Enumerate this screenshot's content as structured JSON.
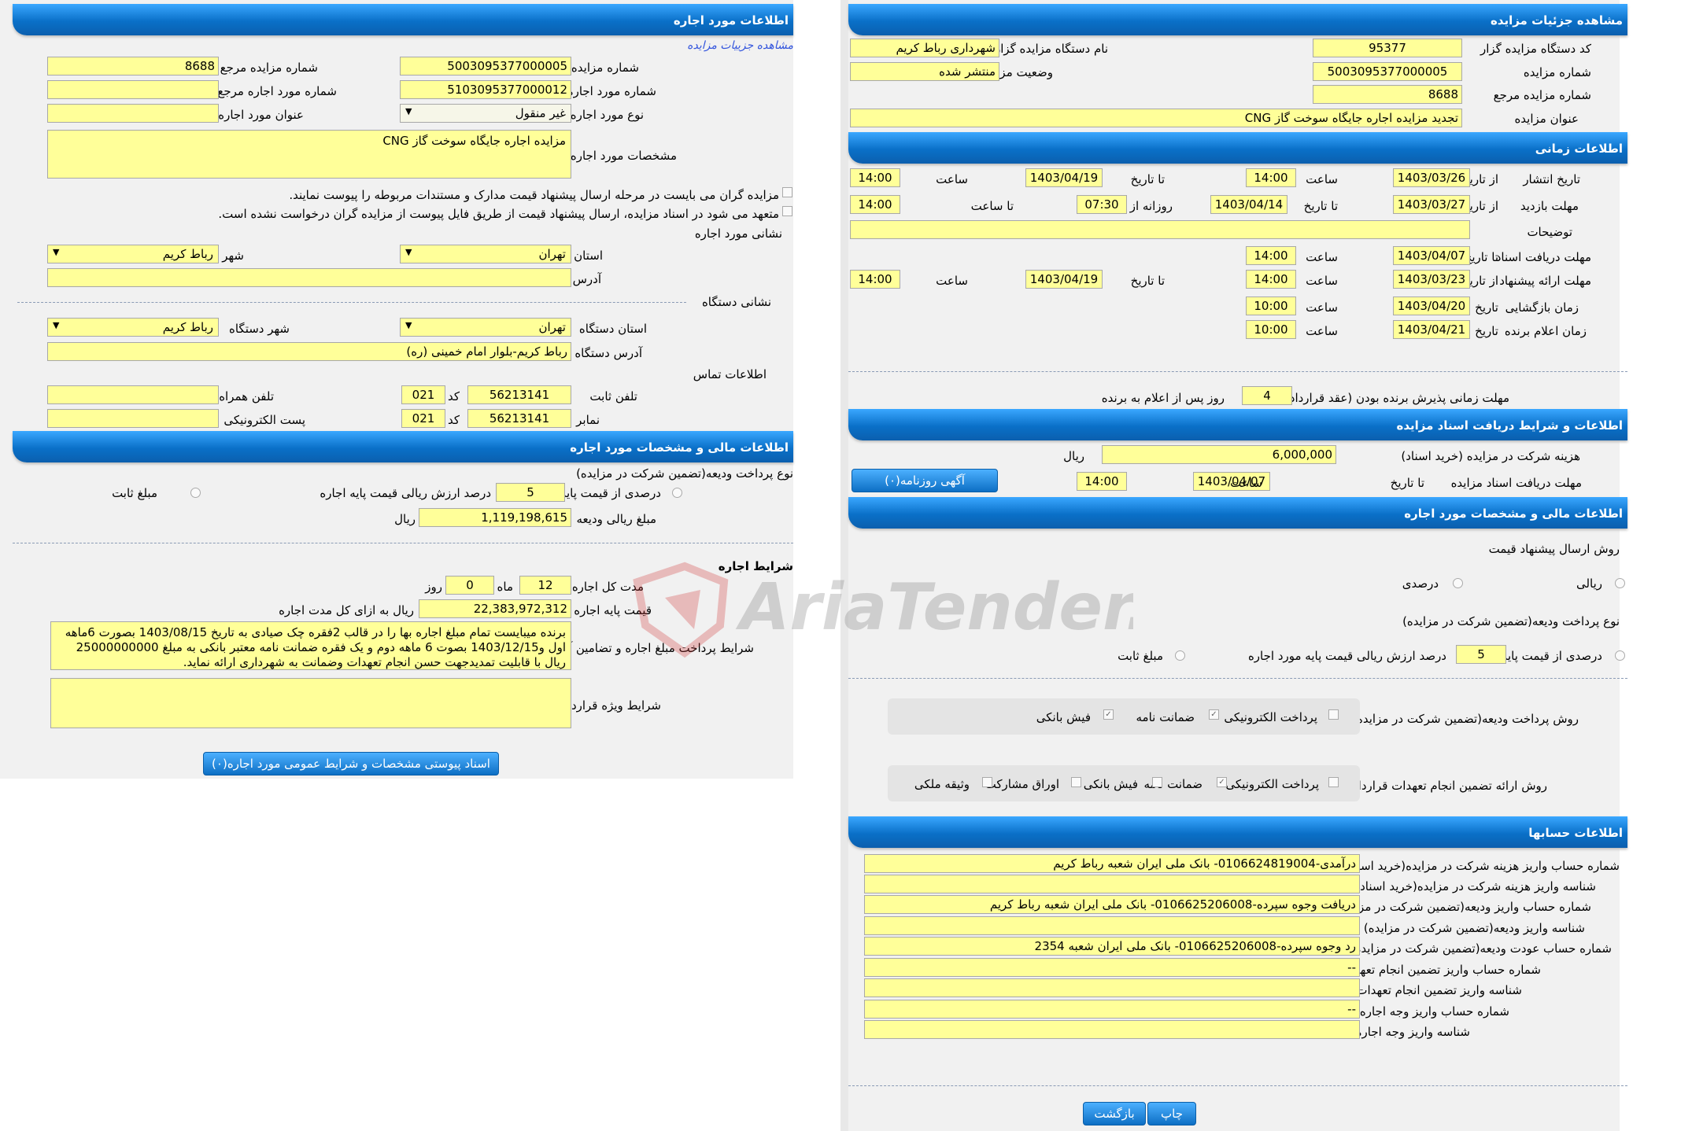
{
  "right": {
    "h_details": "مشاهده جزئیات مزایده",
    "org_code_label": "کد دستگاه مزایده گزار",
    "org_code": "95377",
    "org_name_label": "نام دستگاه مزایده گزار",
    "org_name": "شهرداری رباط کریم",
    "auction_no_label": "شماره مزایده",
    "auction_no": "5003095377000005",
    "status_label": "وضعیت مزایده",
    "status": "منتشر شده",
    "ref_no_label": "شماره مزایده مرجع",
    "ref_no": "8688",
    "title_label": "عنوان مزایده",
    "title": "تجدید مزایده اجاره جایگاه سوخت گاز CNG",
    "h_time": "اطلاعات زمانی",
    "publish_label": "تاریخ انتشار",
    "visit_label": "مهلت بازدید",
    "notes_label": "توضیحات",
    "docs_deadline_label": "مهلت دریافت اسناد",
    "offer_deadline_label": "مهلت ارائه پیشنهاد",
    "opening_label": "زمان بازگشایی",
    "winner_label": "زمان اعلام برنده",
    "from_date": "از تاریخ",
    "to_date": "تا تاریخ",
    "time": "ساعت",
    "date": "تاریخ",
    "daily_from": "روزانه از ساعت",
    "to_time": "تا ساعت",
    "publish_from": "1403/03/26",
    "publish_from_time": "14:00",
    "publish_to": "1403/04/19",
    "publish_to_time": "14:00",
    "visit_from": "1403/03/27",
    "visit_to": "1403/04/14",
    "visit_start": "07:30",
    "visit_end": "14:00",
    "docs_to": "1403/04/07",
    "docs_time": "14:00",
    "offer_from": "1403/03/23",
    "offer_from_time": "14:00",
    "offer_to": "1403/04/19",
    "offer_to_time": "14:00",
    "opening_date": "1403/04/20",
    "opening_time": "10:00",
    "winner_date": "1403/04/21",
    "winner_time": "10:00",
    "accept_label": "مهلت زمانی پذیرش برنده بودن (عقد قرارداد)",
    "accept_days": "4",
    "accept_suffix": "روز پس از اعلام به برنده",
    "h_docs": "اطلاعات و شرایط دریافت اسناد مزایده",
    "fee_label": "هزینه شرکت در مزایده (خرید اسناد)",
    "fee": "6,000,000",
    "rial": "ریال",
    "docs_recv_label": "مهلت دریافت اسناد مزایده",
    "docs_recv_to": "تا تاریخ",
    "docs_recv_date": "1403/04/07",
    "docs_recv_time": "14:00",
    "newspaper_btn": "آگهی روزنامه(۰)",
    "h_fin": "اطلاعات مالی و مشخصات مورد اجاره",
    "price_method_label": "روش ارسال پیشنهاد قیمت",
    "rial_opt": "ریالی",
    "percent_opt": "درصدی",
    "deposit_type_label": "نوع پرداخت ودیعه(تضمین شرکت در مزایده)",
    "percent_base_label": "درصدی از قیمت پایه",
    "percent_value": "5",
    "percent_desc": "درصد ارزش ریالی قیمت پایه مورد اجاره",
    "fixed_label": "مبلغ ثابت",
    "deposit_method_label": "روش پرداخت ودیعه(تضمین شرکت در مزایده)",
    "guarantee_method_label": "روش ارائه تضمین انجام تعهدات قرارداد",
    "electronic": "پرداخت الکترونیکی",
    "guarantee_letter": "ضمانت نامه",
    "bank_receipt": "فیش بانکی",
    "bonds": "اوراق مشارکت",
    "property": "وثیقه ملکی",
    "h_accounts": "اطلاعات حسابها",
    "acc1_label": "شماره حساب واریز هزینه شرکت در مزایده(خرید اسناد)",
    "acc1": "درآمدی-0106624819004- بانک ملی ایران شعبه رباط کریم",
    "acc2_label": "شناسه واریز هزینه شرکت در مزایده(خرید اسناد)",
    "acc2": "",
    "acc3_label": "شماره حساب واریز ودیعه(تضمین شرکت در مزایده)",
    "acc3": "دریافت وجوه سپرده-0106625206008- بانک ملی ایران شعبه رباط کریم",
    "acc4_label": "شناسه واریز ودیعه(تضمین شرکت در مزایده)",
    "acc4": "",
    "acc5_label": "شماره حساب عودت ودیعه(تضمین شرکت در مزایده)",
    "acc5": "رد وجوه سپرده-0106625206008- بانک ملی ایران شعبه 2354",
    "acc6_label": "شماره حساب واریز تضمین انجام تعهدات",
    "acc6": "--",
    "acc7_label": "شناسه واریز تضمین انجام تعهدات",
    "acc7": "",
    "acc8_label": "شماره حساب واریز وجه اجاره",
    "acc8": "--",
    "acc9_label": "شناسه واریز وجه اجاره",
    "acc9": "",
    "print_btn": "چاپ",
    "back_btn": "بازگشت"
  },
  "left": {
    "h_item": "اطلاعات مورد اجاره",
    "view_link": "مشاهده جزییات مزایده",
    "auction_no_label": "شماره مزایده",
    "auction_no": "5003095377000005",
    "ref_no_label": "شماره مزایده مرجع",
    "ref_no": "8688",
    "item_no_label": "شماره مورد اجاره",
    "item_no": "5103095377000012",
    "item_ref_label": "شماره مورد اجاره مرجع",
    "item_ref": "",
    "item_type_label": "نوع مورد اجاره",
    "item_type": "غیر منقول",
    "item_title_label": "عنوان مورد اجاره",
    "item_title": "",
    "spec_label": "مشخصات مورد اجاره",
    "spec": "مزایده اجاره جایگاه سوخت گاز CNG",
    "notice1": "مزایده گران می بایست در مرحله ارسال پیشنهاد قیمت مدارک و مستندات مربوطه را پیوست نمایند.",
    "notice2": "متعهد می شود در اسناد مزایده، ارسال پیشنهاد قیمت از طریق فایل پیوست از مزایده گران درخواست نشده است.",
    "address_section": "نشانی مورد اجاره",
    "province_label": "استان",
    "province": "تهران",
    "city_label": "شهر",
    "city": "رباط کریم",
    "address_label": "آدرس",
    "address": "",
    "org_address_section": "نشانی دستگاه",
    "org_province_label": "استان دستگاه",
    "org_province": "تهران",
    "org_city_label": "شهر دستگاه",
    "org_city": "رباط کریم",
    "org_address_label": "آدرس دستگاه",
    "org_address": "رباط کریم-بلوار امام خمینی (ره)",
    "contact_section": "اطلاعات تماس",
    "phone_label": "تلفن ثابت",
    "phone": "56213141",
    "code_label": "کد",
    "phone_code": "021",
    "mobile_label": "تلفن همراه",
    "mobile": "",
    "fax_label": "نمابر",
    "fax": "56213141",
    "fax_code": "021",
    "email_label": "پست الکترونیکی",
    "email": "",
    "h_fin": "اطلاعات مالی و مشخصات مورد اجاره",
    "deposit_type_label": "نوع پرداخت ودیعه(تضمین شرکت در مزایده)",
    "percent_base_label": "درصدی از قیمت پایه",
    "percent_value": "5",
    "percent_desc": "درصد ارزش ریالی قیمت پایه اجاره",
    "fixed_label": "مبلغ ثابت",
    "deposit_amount_label": "مبلغ ریالی ودیعه",
    "deposit_amount": "1,119,198,615",
    "rial": "ریال",
    "lease_terms": "شرایط اجاره",
    "duration_label": "مدت کل اجاره",
    "months": "12",
    "month_label": "ماه",
    "days": "0",
    "day_label": "روز",
    "base_price_label": "قیمت پایه اجاره",
    "base_price": "22,383,972,312",
    "base_price_suffix": "ریال به ازای کل مدت اجاره",
    "payment_label": "شرایط پرداخت مبلغ اجاره و تضامین آن",
    "payment": "برنده میبایست تمام مبلغ اجاره بها را در قالب 2فقره چک صیادی به تاریخ 1403/08/15 بصورت 6ماهه اول و1403/12/15 بصوت 6 ماهه دوم و یک فقره ضمانت نامه معتبر بانکی به مبلغ 25000000000 ریال با قابلیت تمدیدجهت حسن انجام تعهدات وضمانت به شهرداری ارائه نماید.",
    "special_label": "شرایط ویژه قرارداد",
    "special": "",
    "attach_btn": "اسناد پیوستی مشخصات و شرایط عمومی مورد اجاره(۰)"
  },
  "watermark": "AriaTender.neT"
}
